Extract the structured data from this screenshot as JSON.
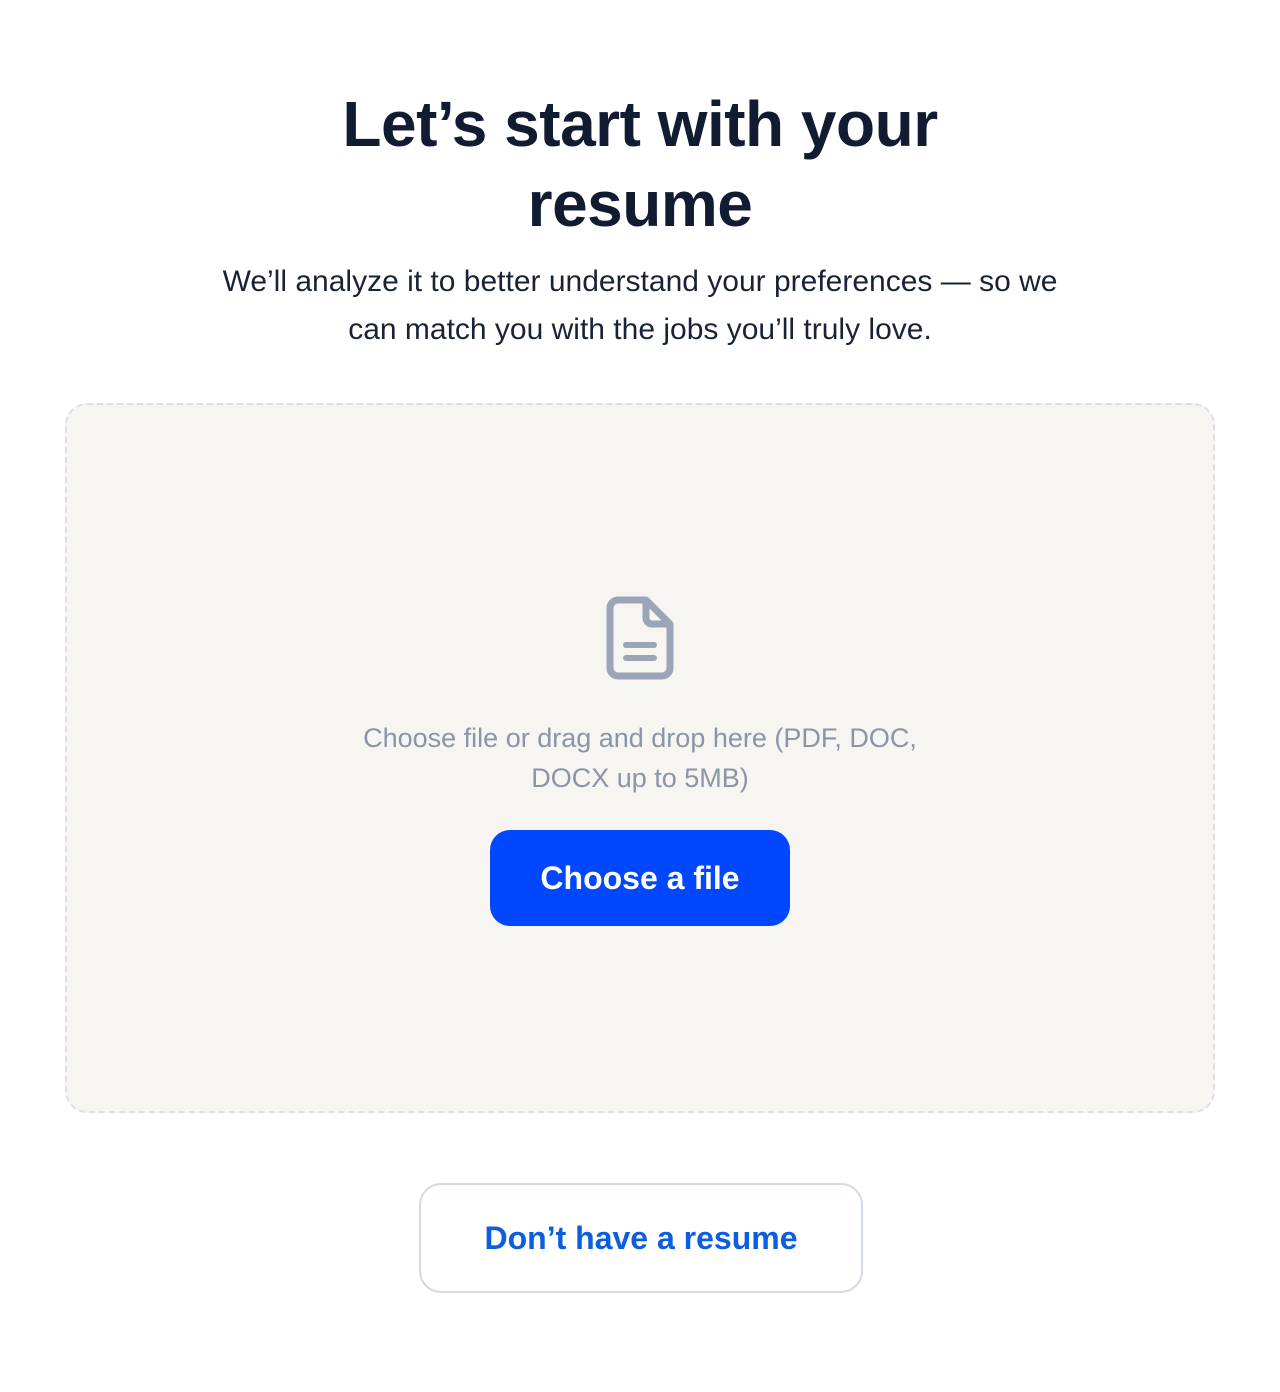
{
  "header": {
    "title": "Let’s start with your resume",
    "subtitle": "We’ll analyze it to better understand your preferences — so we can match you with the jobs you’ll truly love."
  },
  "upload": {
    "icon": "document-icon",
    "hint": "Choose file or drag and drop here (PDF, DOC, DOCX up to 5MB)",
    "button_label": "Choose a file"
  },
  "footer": {
    "no_resume_label": "Don’t have a resume"
  },
  "colors": {
    "primary": "#0047ff",
    "link": "#0b5ee0",
    "dropzone_bg": "#f6f5f2",
    "heading": "#111c33",
    "muted": "#8b95a5",
    "icon": "#9aa5b8"
  }
}
